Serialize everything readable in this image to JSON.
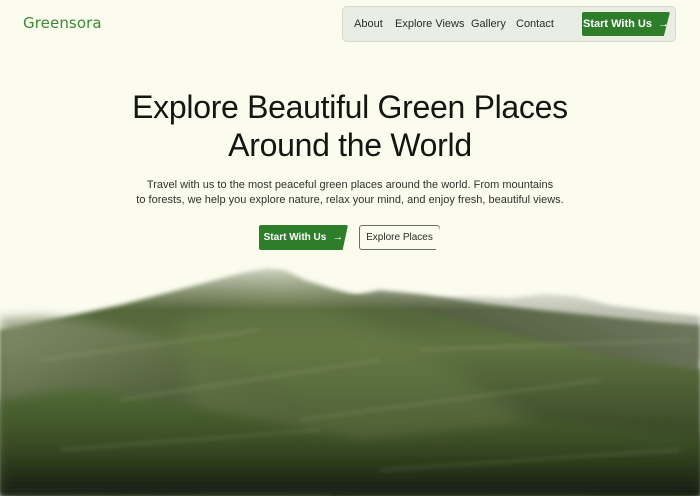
{
  "brand": {
    "name": "Greensora"
  },
  "nav": {
    "items": [
      {
        "label": "About"
      },
      {
        "label": "Explore Views"
      },
      {
        "label": "Gallery"
      },
      {
        "label": "Contact"
      }
    ],
    "cta_label": "Start With Us"
  },
  "hero": {
    "title_line1": "Explore Beautiful Green Places",
    "title_line2": "Around the World",
    "subtitle_line1": "Travel with us to the most peaceful green places around the world. From mountains",
    "subtitle_line2": "to forests, we help you explore nature, relax your mind, and enjoy fresh, beautiful views.",
    "primary_button": "Start With Us",
    "secondary_button": "Explore Places"
  },
  "icons": {
    "arrow": "arrow-right-icon"
  },
  "colors": {
    "background": "#fbfcee",
    "brand_green": "#2e7d2b",
    "logo_green": "#3a8a34",
    "mountain_dark": "#2b3a1f",
    "mountain_mid": "#5b6e3f"
  }
}
